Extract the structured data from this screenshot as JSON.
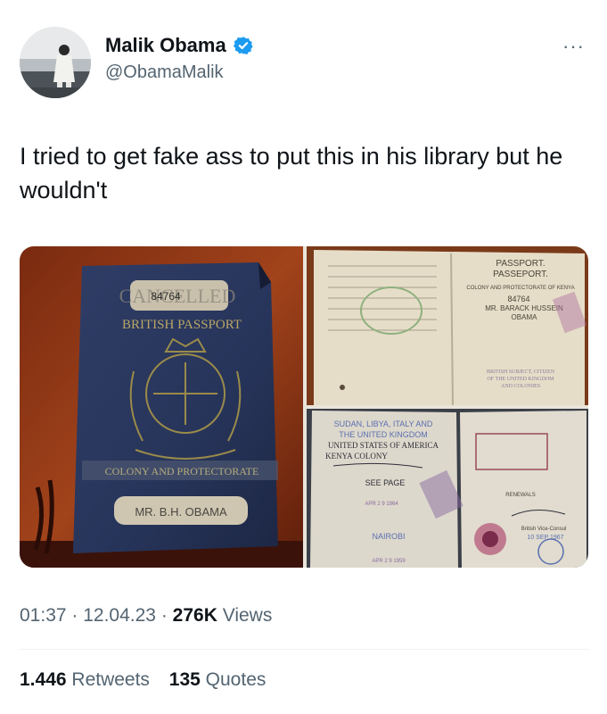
{
  "author": {
    "display_name": "Malik Obama",
    "handle": "@ObamaMalik",
    "verified": true,
    "verified_color": "#1d9bf0"
  },
  "more_icon": "···",
  "tweet": {
    "text": "I tried to get fake ass to put this in his library but he wouldn't"
  },
  "media": {
    "cover": {
      "stamp": "CANCELLED",
      "number": "84764",
      "title": "BRITISH PASSPORT",
      "band": "COLONY AND PROTECTORATE",
      "name_label": "MR. B.H. OBAMA"
    },
    "page_top": {
      "heading_1": "PASSPORT.",
      "heading_2": "PASSEPORT.",
      "colony": "COLONY AND PROTECTORATE OF KENYA",
      "number": "84764",
      "holder": "MR. BARACK HUSSEIN",
      "surname": "OBAMA",
      "nationality_1": "BRITISH SUBJECT, CITIZEN",
      "nationality_2": "OF THE UNITED KINGDOM",
      "nationality_3": "AND COLONIES"
    },
    "page_bottom": {
      "countries_1": "SUDAN, LIBYA, ITALY AND",
      "countries_2": "THE UNITED KINGDOM",
      "countries_3": "UNITED STATES OF AMERICA",
      "countries_4": "KENYA COLONY",
      "see_page": "SEE PAGE",
      "date_1": "APR 2 9 1964",
      "issued_at": "NAIROBI",
      "date_2": "APR 2 9 1959",
      "renewals": "RENEWALS",
      "consul": "British Vice-Consul",
      "sep": "10 SEP 1967"
    }
  },
  "meta": {
    "time": "01:37",
    "sep1": " · ",
    "date": "12.04.23",
    "sep2": " · ",
    "views_count": "276K",
    "views_label": " Views"
  },
  "stats": {
    "retweets_count": "1.446",
    "retweets_label": " Retweets",
    "quotes_count": "135",
    "quotes_label": " Quotes"
  }
}
